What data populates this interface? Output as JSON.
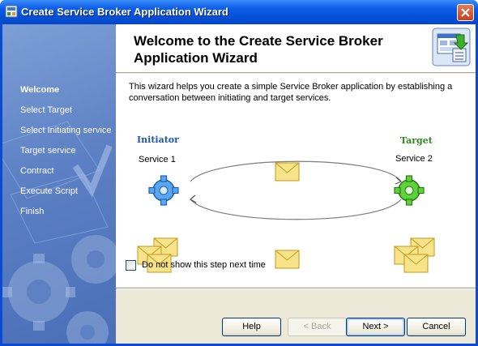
{
  "window": {
    "title": "Create Service Broker Application Wizard",
    "close_label": "Close"
  },
  "sidebar": {
    "steps": [
      {
        "label": "Welcome",
        "active": true
      },
      {
        "label": "Select Target",
        "active": false
      },
      {
        "label": "Select Initiating service",
        "active": false
      },
      {
        "label": "Target service",
        "active": false
      },
      {
        "label": "Contract",
        "active": false
      },
      {
        "label": "Execute Script",
        "active": false
      },
      {
        "label": "Finish",
        "active": false
      }
    ]
  },
  "header": {
    "title": "Welcome to the Create Service Broker Application Wizard",
    "icon": "wizard-app-icon"
  },
  "body": {
    "description": "This wizard helps you create a simple Service Broker application by establishing a conversation between initiating and target services.",
    "diagram": {
      "initiator_label": "Initiator",
      "initiator_service": "Service 1",
      "target_label": "Target",
      "target_service": "Service 2",
      "initiator_color": "#1c5aa8",
      "target_color": "#2f8a1e"
    },
    "checkbox": {
      "label": "Do not show this step next time",
      "checked": false
    }
  },
  "buttons": {
    "help": "Help",
    "back": "< Back",
    "next": "Next >",
    "cancel": "Cancel"
  }
}
